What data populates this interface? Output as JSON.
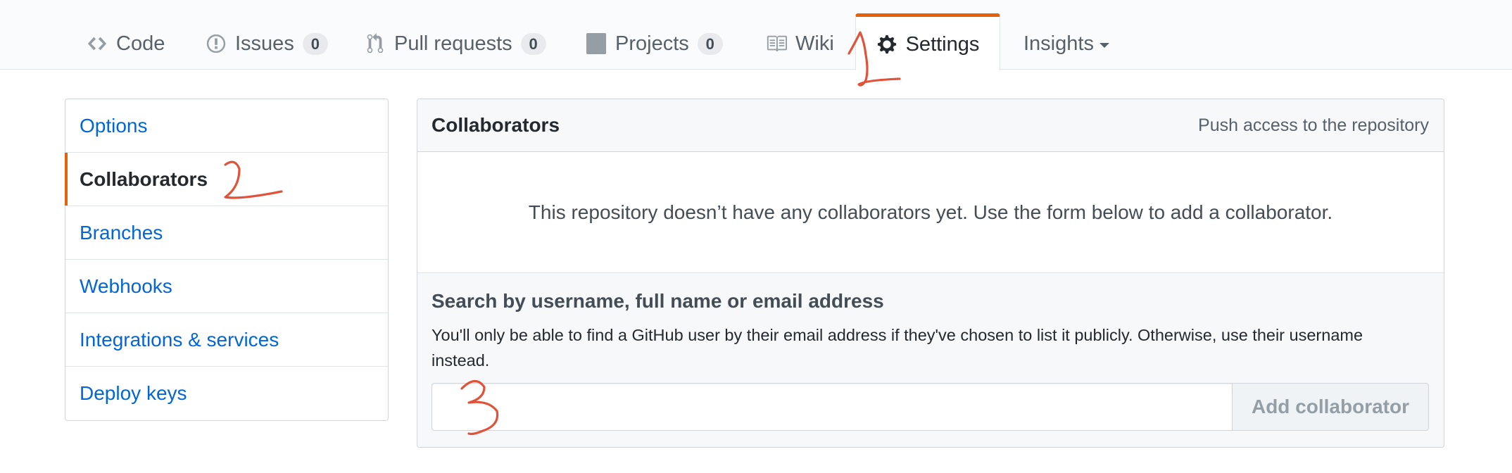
{
  "repo_nav": {
    "tabs": [
      {
        "label": "Code",
        "icon": "code-icon",
        "counter": null
      },
      {
        "label": "Issues",
        "icon": "issue-opened-icon",
        "counter": "0"
      },
      {
        "label": "Pull requests",
        "icon": "git-pull-request-icon",
        "counter": "0"
      },
      {
        "label": "Projects",
        "icon": "project-icon",
        "counter": "0"
      },
      {
        "label": "Wiki",
        "icon": "book-icon",
        "counter": null
      },
      {
        "label": "Settings",
        "icon": "gear-icon",
        "counter": null,
        "selected": true
      },
      {
        "label": "Insights",
        "icon": "triangle-down-icon",
        "counter": null
      }
    ]
  },
  "settings_menu": {
    "items": [
      {
        "label": "Options"
      },
      {
        "label": "Collaborators",
        "selected": true
      },
      {
        "label": "Branches"
      },
      {
        "label": "Webhooks"
      },
      {
        "label": "Integrations & services"
      },
      {
        "label": "Deploy keys"
      }
    ]
  },
  "collaborators": {
    "title": "Collaborators",
    "note": "Push access to the repository",
    "blankslate": "This repository doesn’t have any collaborators yet. Use the form below to add a collaborator.",
    "search_label": "Search by username, full name or email address",
    "search_note": "You'll only be able to find a GitHub user by their email address if they've chosen to list it publicly. Otherwise, use their username instead.",
    "input_value": "",
    "add_button_label": "Add collaborator"
  },
  "colors": {
    "selected_accent": "#e36209",
    "link": "#0366d6",
    "annotation": "#e0533a"
  }
}
